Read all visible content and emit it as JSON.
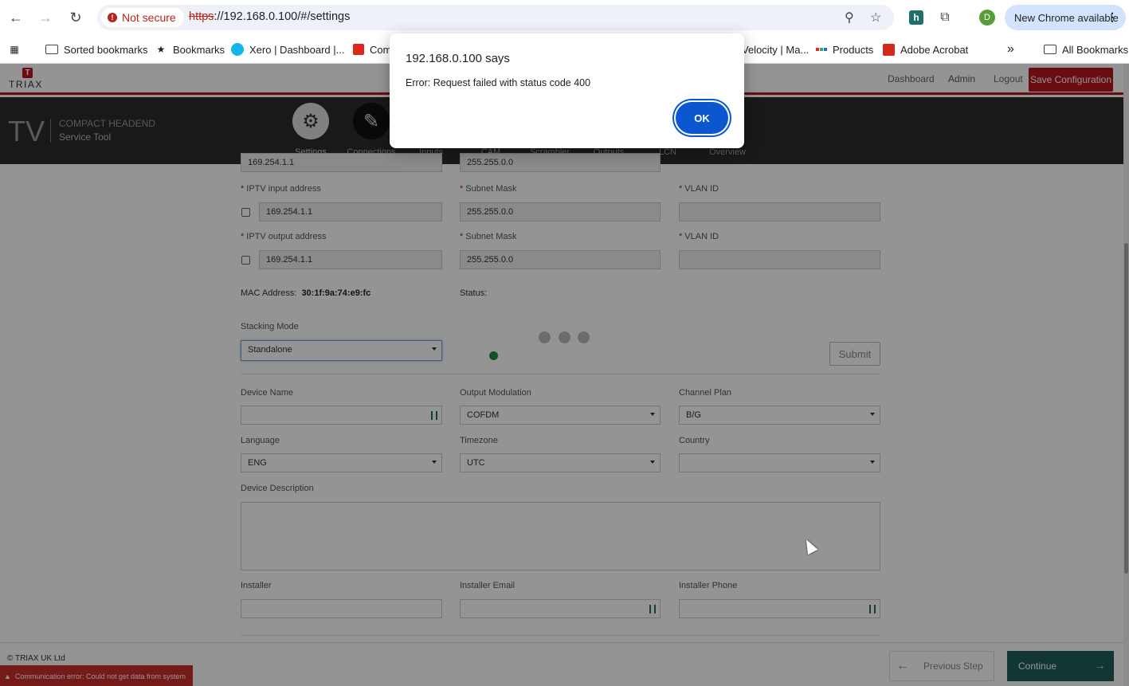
{
  "browser": {
    "security_label": "Not secure",
    "url_scheme": "https",
    "url_rest": "://192.168.0.100/#/settings",
    "avatar_letter": "D",
    "new_chrome_label": "New Chrome available",
    "bookmarks": [
      {
        "label": "Sorted bookmarks",
        "icon": "folder-icon"
      },
      {
        "label": "Bookmarks",
        "icon": "star-icon"
      },
      {
        "label": "Xero | Dashboard |...",
        "icon": "xero-icon"
      },
      {
        "label": "Com",
        "icon": "app-icon"
      },
      {
        "label": "Velocity | Ma...",
        "icon": "none"
      },
      {
        "label": "Products",
        "icon": "products-icon"
      },
      {
        "label": "Adobe Acrobat",
        "icon": "acrobat-icon"
      }
    ],
    "all_bookmarks_label": "All Bookmarks",
    "overflow_label": "»"
  },
  "app": {
    "logo_mark": "T",
    "logo_word": "TRIAX",
    "nav": {
      "dashboard": "Dashboard",
      "admin": "Admin",
      "logout": "Logout"
    },
    "save_label": "Save Configuration",
    "hero_tv": "TV",
    "hero_line1": "COMPACT HEADEND",
    "hero_line2": "Service Tool",
    "steps": [
      "Settings",
      "Connections",
      "Inputs",
      "CAM",
      "Scrambler",
      "Outputs",
      "LCN",
      "Overview"
    ]
  },
  "form": {
    "partial_top_ip": "169.254.1.1",
    "partial_top_mask": "255.255.0.0",
    "iptv_input_label": "IPTV input address",
    "iptv_input_value": "169.254.1.1",
    "iptv_output_label": "IPTV output address",
    "iptv_output_value": "169.254.1.1",
    "subnet_label": "Subnet Mask",
    "subnet_value": "255.255.0.0",
    "vlan_label": "VLAN ID",
    "mac_label": "MAC Address:",
    "mac_value": "30:1f:9a:74:e9:fc",
    "status_label": "Status:",
    "status_color": "#1f8a3a",
    "submit_label": "Submit",
    "stacking_label": "Stacking Mode",
    "stacking_value": "Standalone",
    "device_name_label": "Device Name",
    "output_mod_label": "Output Modulation",
    "output_mod_value": "COFDM",
    "channel_plan_label": "Channel Plan",
    "channel_plan_value": "B/G",
    "language_label": "Language",
    "language_value": "ENG",
    "timezone_label": "Timezone",
    "timezone_value": "UTC",
    "country_label": "Country",
    "description_label": "Device Description",
    "installer_label": "Installer",
    "installer_email_label": "Installer Email",
    "installer_phone_label": "Installer Phone"
  },
  "footer": {
    "copyright": "© TRIAX UK Ltd",
    "comm_error": "Communication error: Could not get data from system",
    "prev_label": "Previous Step",
    "continue_label": "Continue"
  },
  "dialog": {
    "title": "192.168.0.100 says",
    "message": "Error: Request failed with status code 400",
    "ok_label": "OK"
  },
  "colors": {
    "brand_red": "#b7151c",
    "chrome_blue": "#0b57d0",
    "continue_teal": "#1e5e5a"
  }
}
